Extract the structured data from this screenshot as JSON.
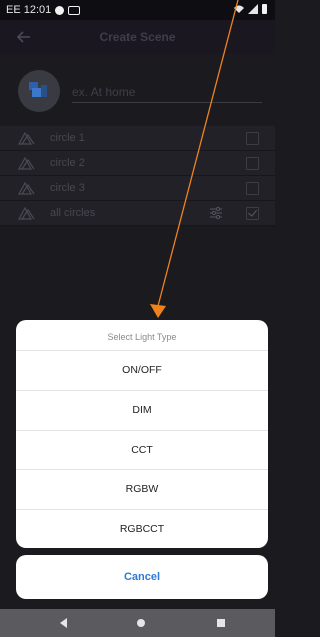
{
  "status_bar": {
    "time": "EE 12:01"
  },
  "app_bar": {
    "title": "Create Scene"
  },
  "scene_name": {
    "placeholder": "ex. At home",
    "value": ""
  },
  "circles": [
    {
      "label": "circle 1",
      "checked": false
    },
    {
      "label": "circle 2",
      "checked": false
    },
    {
      "label": "circle 3",
      "checked": false
    },
    {
      "label": "all circles",
      "checked": true
    }
  ],
  "light_type_sheet": {
    "title": "Select Light Type",
    "options": [
      "ON/OFF",
      "DIM",
      "CCT",
      "RGBW",
      "RGBCCT"
    ],
    "cancel_label": "Cancel"
  },
  "colors": {
    "accent": "#2f7bd8",
    "annotation_arrow": "#f0821e"
  },
  "icons": {
    "back": "arrow-left-icon",
    "lamp": "lamp-icon",
    "tune": "tune-icon",
    "scene": "scene-icon"
  }
}
